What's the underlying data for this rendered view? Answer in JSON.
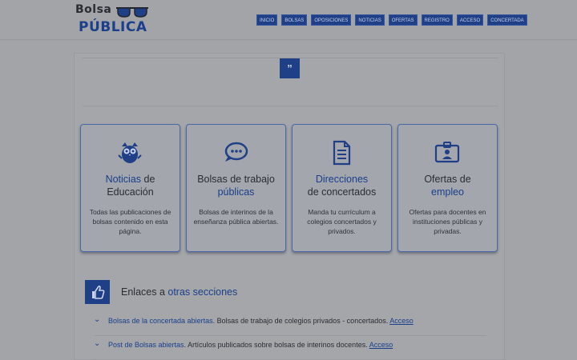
{
  "logo": {
    "top": "Bolsa",
    "bottom": "PÚBLICA"
  },
  "nav": [
    "INICIO",
    "BOLSAS",
    "OPOSICIONES",
    "NOTICIAS",
    "OFERTAS",
    "REGISTRO",
    "ACCESO",
    "CONCERTADA"
  ],
  "quote_mark": "”",
  "cards": [
    {
      "title_hl": "Noticias",
      "title_rest1": " de",
      "title_line2": "Educación",
      "title_line2_hl": "",
      "desc": "Todas las publicaciones de bolsas contenido en esta página.",
      "icon": "owl-icon"
    },
    {
      "title_hl": "",
      "title_rest1": "Bolsas de trabajo",
      "title_line2": "",
      "title_line2_hl": "públicas",
      "desc": "Bolsas de interinos de la enseñanza pública abiertas.",
      "icon": "chat-bubble-icon"
    },
    {
      "title_hl": "Direcciones",
      "title_rest1": "",
      "title_line2": "de concertados",
      "title_line2_hl": "",
      "desc": "Manda tu currículum a colegios concertados y privados.",
      "icon": "document-icon"
    },
    {
      "title_hl": "",
      "title_rest1": "Ofertas de",
      "title_line2": "",
      "title_line2_hl": "empleo",
      "desc": "Ofertas para docentes en instituciones públicas y privadas.",
      "icon": "id-badge-icon"
    }
  ],
  "links_section": {
    "title_plain": "Enlaces a ",
    "title_hl": "otras secciones",
    "icon": "thumbs-up-icon"
  },
  "links": [
    {
      "title": "Bolsas de la concertada abiertas",
      "desc": ". Bolsas de trabajo de colegios privados - concertados. ",
      "action": "Acceso"
    },
    {
      "title": "Post de Bolsas abiertas",
      "desc": ". Artículos publicados sobre bolsas de interinos docentes. ",
      "action": "Acceso"
    }
  ],
  "colors": {
    "accent": "#1f3f86",
    "overlay_bg": "#a2a4a8"
  }
}
